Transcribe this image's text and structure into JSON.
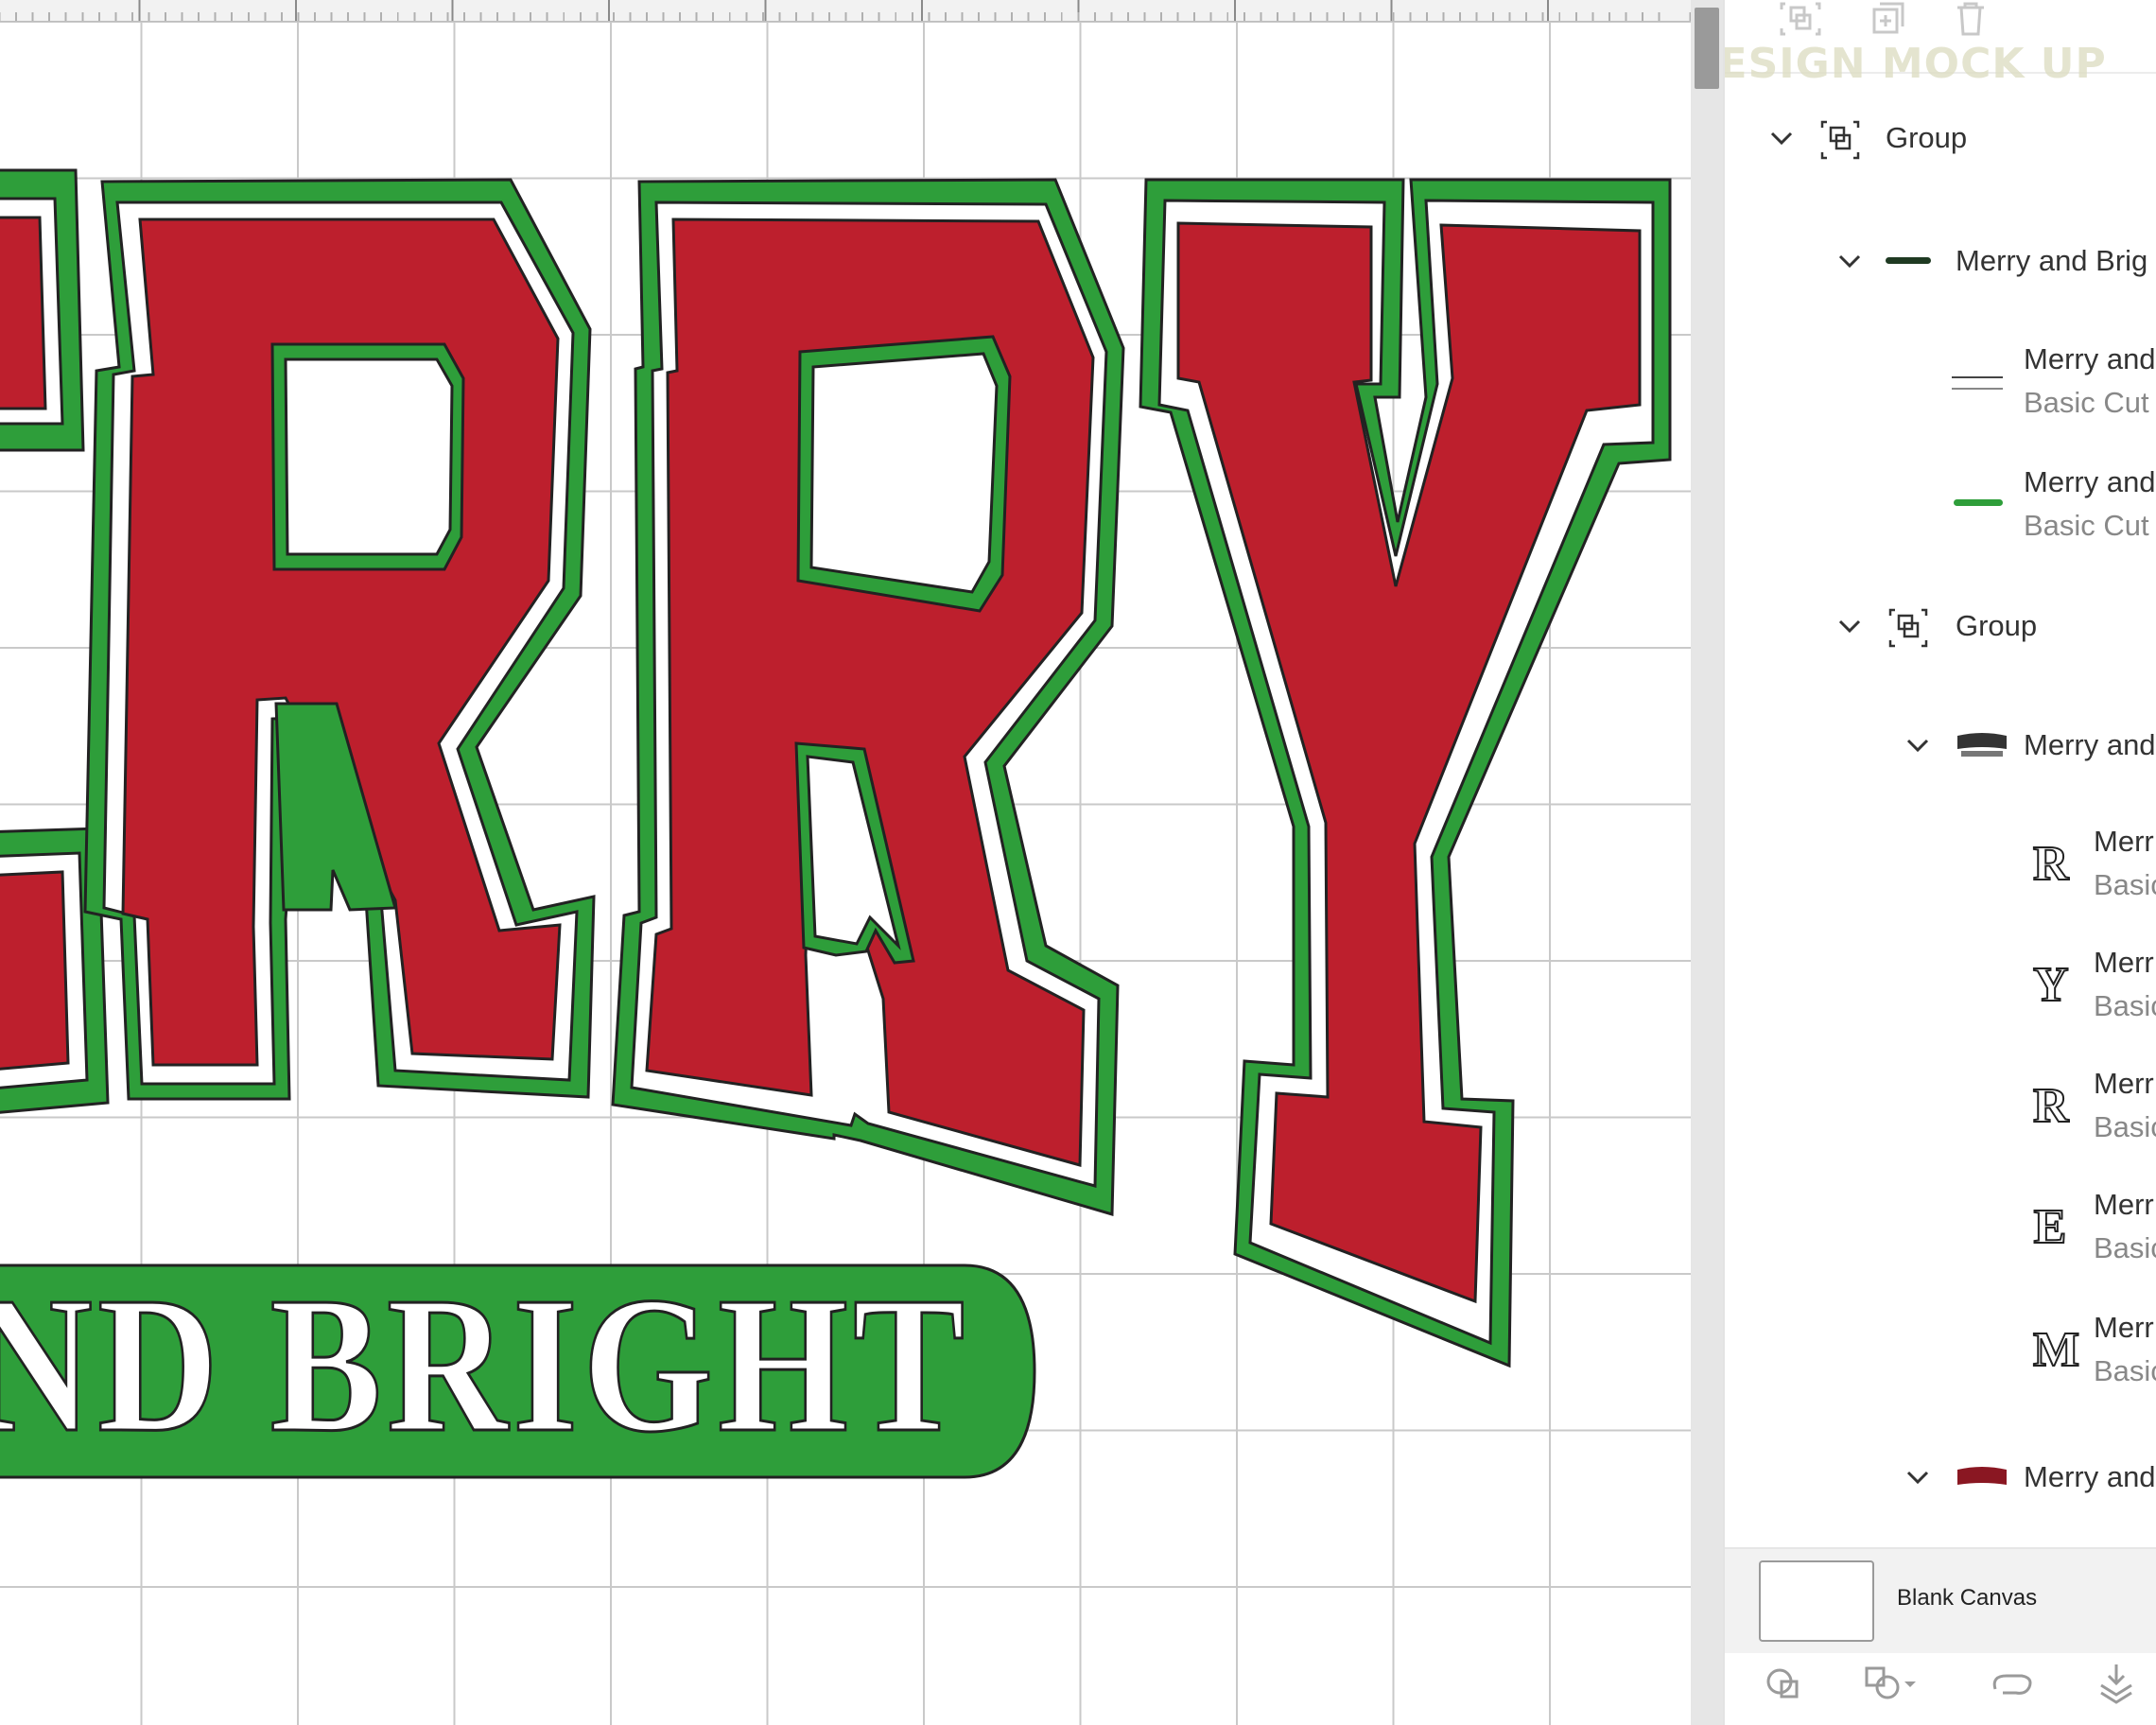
{
  "watermark": "DESIGN MOCK UP",
  "canvas": {
    "main_word_visible": "RRY",
    "band_text": "ND BRIGHT",
    "colors": {
      "red": "#BD1F2D",
      "green": "#2E9E3A",
      "outline": "#222222",
      "grid": "#C9C9C9"
    }
  },
  "panel_toolbar": {
    "icons": [
      "group-icon",
      "duplicate-icon",
      "delete-icon"
    ]
  },
  "layers": [
    {
      "label": "Group",
      "icon": "group-icon",
      "expanded": true
    },
    {
      "label": "Merry and Brig",
      "icon": "dark-line-thumb",
      "expanded": true
    },
    {
      "label": "Merry and",
      "sub": "Basic Cut",
      "icon": "tiny-text-thumb"
    },
    {
      "label": "Merry and",
      "sub": "Basic Cut",
      "icon": "green-line-thumb"
    },
    {
      "label": "Group",
      "icon": "group-icon",
      "expanded": true
    },
    {
      "label": "Merry and",
      "icon": "merry-black-thumb",
      "expanded": true
    },
    {
      "label": "Merr",
      "sub": "Basic",
      "letter": "R"
    },
    {
      "label": "Merr",
      "sub": "Basic",
      "letter": "Y"
    },
    {
      "label": "Merr",
      "sub": "Basic",
      "letter": "R"
    },
    {
      "label": "Merr",
      "sub": "Basic",
      "letter": "E"
    },
    {
      "label": "Merr",
      "sub": "Basic",
      "letter": "M"
    },
    {
      "label": "Merry and",
      "icon": "merry-red-thumb",
      "expanded": true
    }
  ],
  "blank_canvas_label": "Blank Canvas",
  "bottom_tools": [
    "slice-icon",
    "combine-icon",
    "attach-icon",
    "flatten-icon"
  ]
}
